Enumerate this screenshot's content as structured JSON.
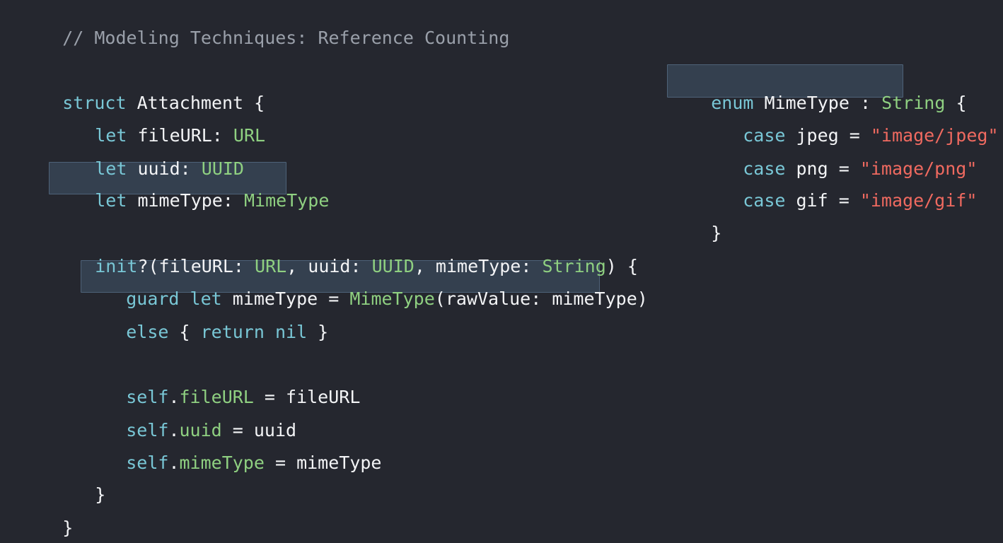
{
  "comment": "// Modeling Techniques: Reference Counting",
  "struct_decl": {
    "kw": "struct",
    "name": "Attachment",
    "brace": "{"
  },
  "props": [
    {
      "kw": "let",
      "name": "fileURL",
      "sep": ": ",
      "type": "URL"
    },
    {
      "kw": "let",
      "name": "uuid",
      "sep": ": ",
      "type": "UUID"
    },
    {
      "kw": "let",
      "name": "mimeType",
      "sep": ": ",
      "type": "MimeType"
    }
  ],
  "init_line": {
    "kw": "init",
    "open": "?(fileURL: ",
    "t1": "URL",
    "mid1": ", uuid: ",
    "t2": "UUID",
    "mid2": ", mimeType: ",
    "t3": "String",
    "close": ") {"
  },
  "guard_line": {
    "kw1": "guard",
    "kw2": "let",
    "lhs": "mimeType = ",
    "type": "MimeType",
    "rest": "(rawValue: mimeType)"
  },
  "else_line": {
    "kw1": "else",
    "brace_open": " { ",
    "kw2": "return",
    "kw3": "nil",
    "brace_close": " }"
  },
  "assignments": [
    {
      "self": "self",
      "dot": ".",
      "prop": "fileURL",
      "rest": " = fileURL"
    },
    {
      "self": "self",
      "dot": ".",
      "prop": "uuid",
      "rest": " = uuid"
    },
    {
      "self": "self",
      "dot": ".",
      "prop": "mimeType",
      "rest": " = mimeType"
    }
  ],
  "init_close": "}",
  "struct_close": "}",
  "enum_decl": {
    "kw": "enum",
    "name": "MimeType",
    "colon": " : ",
    "type": "String",
    "brace": "{"
  },
  "cases": [
    {
      "kw": "case",
      "name": "jpeg",
      "eq": " = ",
      "value": "\"image/jpeg\""
    },
    {
      "kw": "case",
      "name": "png",
      "eq": " = ",
      "value": "\"image/png\""
    },
    {
      "kw": "case",
      "name": "gif",
      "eq": " = ",
      "value": "\"image/gif\""
    }
  ],
  "enum_close": "}",
  "colors": {
    "background": "#25272f",
    "keyword": "#79c7d6",
    "type": "#8fd081",
    "string": "#f06a60",
    "comment": "#9aa0aa",
    "highlight": "#34404f"
  }
}
